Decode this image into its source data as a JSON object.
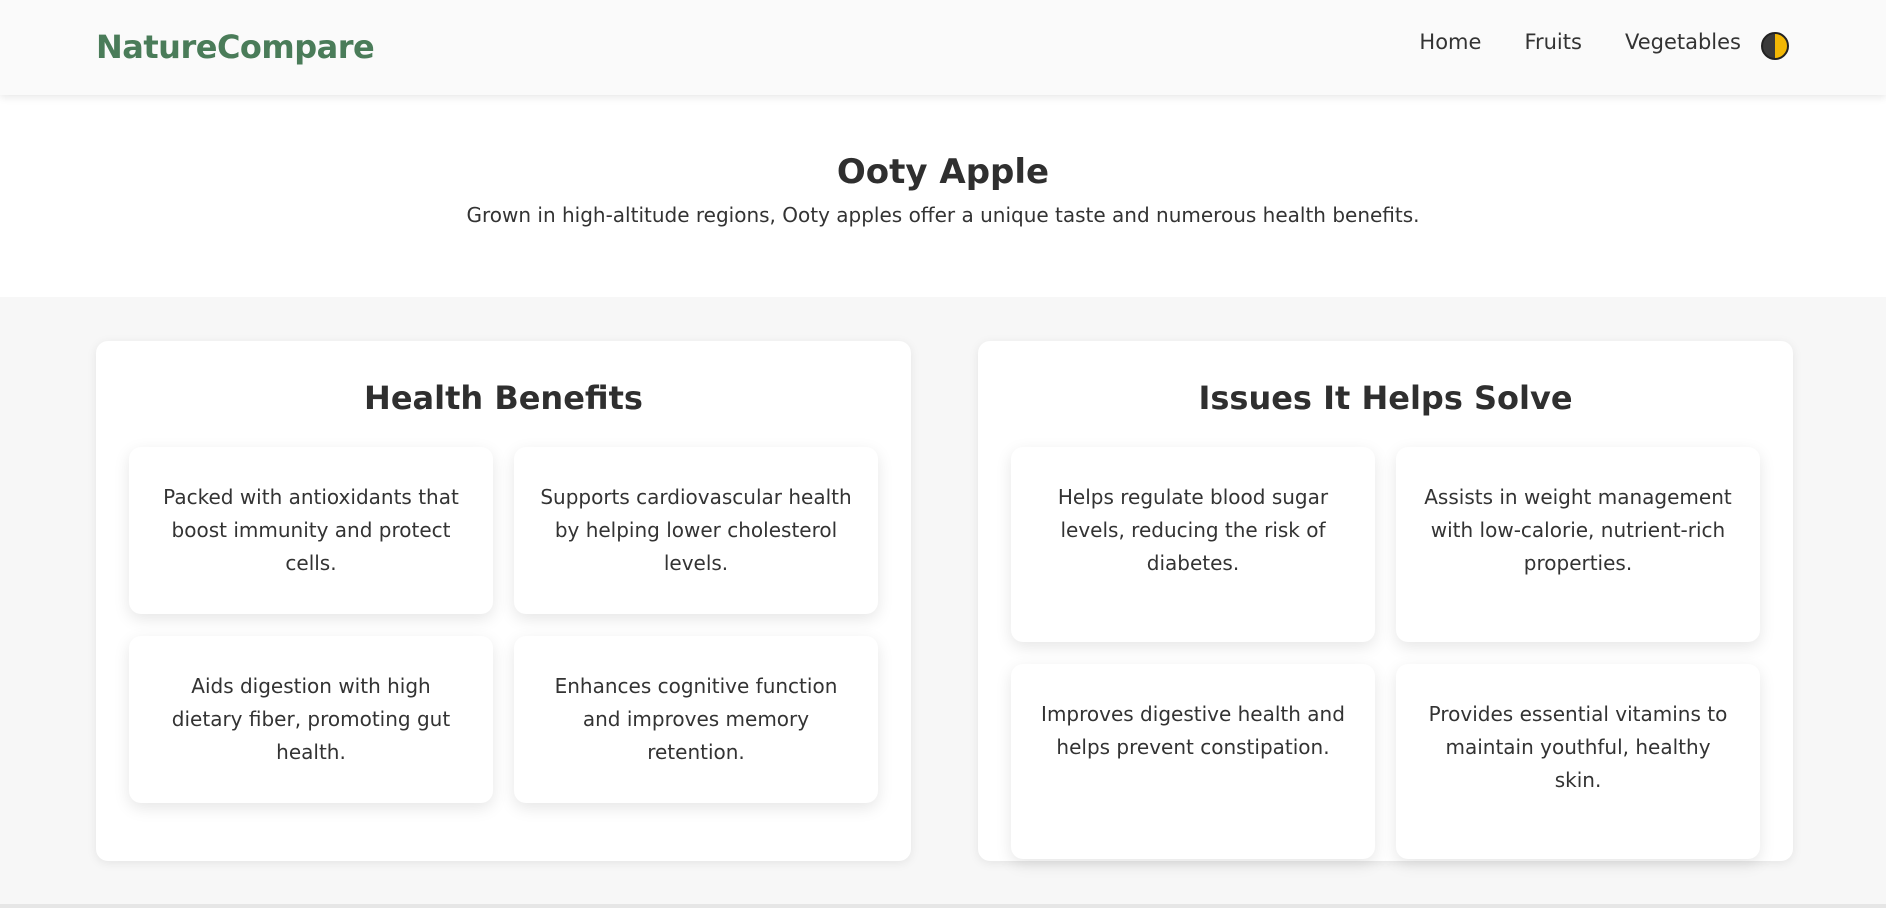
{
  "brand": "NatureCompare",
  "nav": {
    "items": [
      "Home",
      "Fruits",
      "Vegetables"
    ]
  },
  "hero": {
    "title": "Ooty Apple",
    "subtitle": "Grown in high-altitude regions, Ooty apples offer a unique taste and numerous health benefits."
  },
  "benefits": {
    "title": "Health Benefits",
    "items": [
      "Packed with antioxidants that boost immunity and protect cells.",
      "Supports cardiovascular health by helping lower cholesterol levels.",
      "Aids digestion with high dietary fiber, promoting gut health.",
      "Enhances cognitive function and improves memory retention."
    ]
  },
  "issues": {
    "title": "Issues It Helps Solve",
    "items": [
      "Helps regulate blood sugar levels, reducing the risk of diabetes.",
      "Assists in weight management with low-calorie, nutrient-rich properties.",
      "Improves digestive health and helps prevent constipation.",
      "Provides essential vitamins to maintain youthful, healthy skin."
    ]
  },
  "colors": {
    "brand": "#4a7c59",
    "text": "#333333",
    "page_bg": "#f7f7f7",
    "card_bg": "#ffffff",
    "toggle_dark": "#3a3a3a",
    "toggle_light": "#f2b705"
  },
  "icons": {
    "theme_toggle": "half-moon-theme-icon"
  }
}
